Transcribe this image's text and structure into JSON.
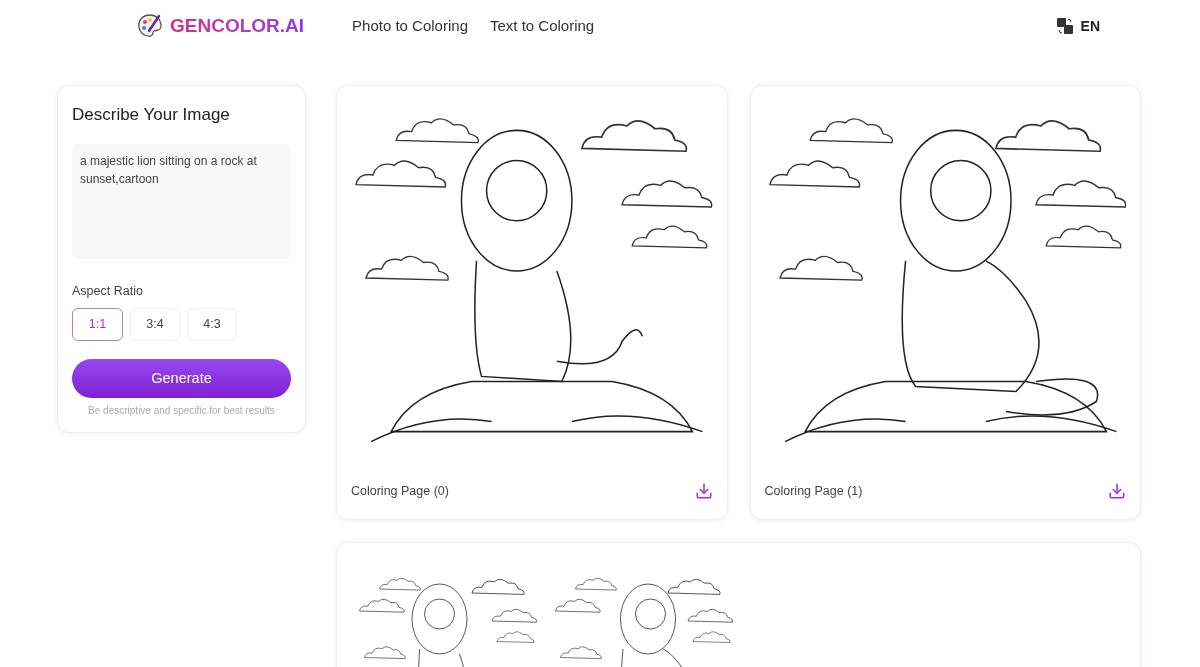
{
  "header": {
    "brand": "GENCOLOR.AI",
    "nav": [
      {
        "label": "Photo to Coloring"
      },
      {
        "label": "Text to Coloring"
      }
    ],
    "language": "EN"
  },
  "prompt_panel": {
    "title": "Describe Your Image",
    "prompt": "a majestic lion sitting on a rock at sunset,cartoon",
    "aspect_label": "Aspect Ratio",
    "ratios": [
      {
        "label": "1:1",
        "selected": true
      },
      {
        "label": "3:4",
        "selected": false
      },
      {
        "label": "4:3",
        "selected": false
      }
    ],
    "button": "Generate",
    "hint": "Be descriptive and specific for best results"
  },
  "results": [
    {
      "caption": "Coloring Page (0)"
    },
    {
      "caption": "Coloring Page (1)"
    }
  ]
}
